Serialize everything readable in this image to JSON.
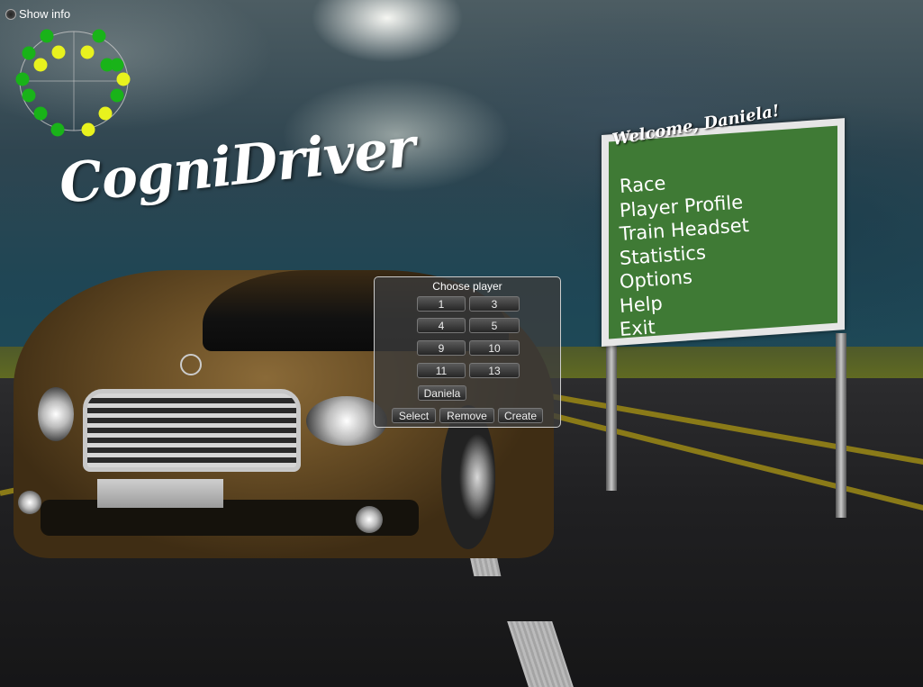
{
  "show_info": {
    "label": "Show info"
  },
  "logo": {
    "text": "CogniDriver"
  },
  "sign": {
    "welcome": "Welcome, Daniela!",
    "menu": [
      "Race",
      "Player Profile",
      "Train Headset",
      "Statistics",
      "Options",
      "Help",
      "Exit"
    ]
  },
  "dialog": {
    "title": "Choose player",
    "players": [
      "1",
      "3",
      "4",
      "5",
      "9",
      "10",
      "11",
      "13"
    ],
    "current_player": "Daniela",
    "actions": {
      "select": "Select",
      "remove": "Remove",
      "create": "Create"
    }
  },
  "headset_sensors": {
    "colors": {
      "green": "#19b319",
      "yellow": "#e8f21e"
    }
  }
}
